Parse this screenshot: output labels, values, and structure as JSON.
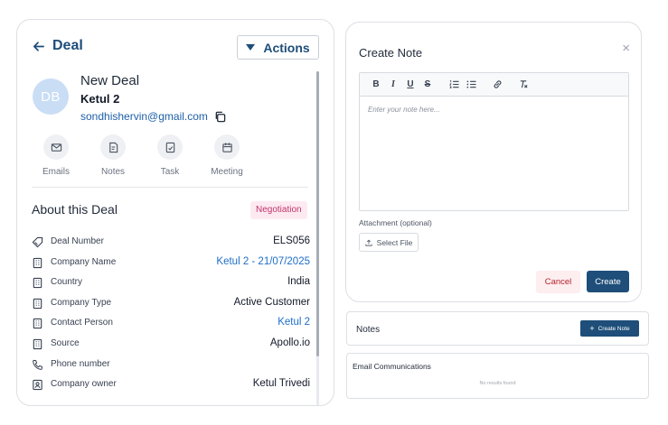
{
  "deal": {
    "back_label": "Deal",
    "actions_label": "Actions",
    "avatar_initials": "DB",
    "deal_name": "New Deal",
    "contact_name": "Ketul 2",
    "contact_email": "sondhishervin@gmail.com",
    "quick_actions": [
      {
        "label": "Emails",
        "icon": "mail-icon"
      },
      {
        "label": "Notes",
        "icon": "notes-icon"
      },
      {
        "label": "Task",
        "icon": "task-icon"
      },
      {
        "label": "Meeting",
        "icon": "calendar-icon"
      }
    ],
    "about_title": "About this Deal",
    "stage_badge": "Negotiation",
    "stage_badge_color": "#c2346b",
    "details": [
      {
        "label": "Deal Number",
        "value": "ELS056",
        "icon": "tag-icon",
        "link": false
      },
      {
        "label": "Company Name",
        "value": "Ketul 2 - 21/07/2025",
        "icon": "building-icon",
        "link": true
      },
      {
        "label": "Country",
        "value": "India",
        "icon": "building-icon",
        "link": false
      },
      {
        "label": "Company Type",
        "value": "Active Customer",
        "icon": "building-icon",
        "link": false
      },
      {
        "label": "Contact Person",
        "value": "Ketul 2",
        "icon": "building-icon",
        "link": true
      },
      {
        "label": "Source",
        "value": "Apollo.io",
        "icon": "building-icon",
        "link": false
      },
      {
        "label": "Phone number",
        "value": "",
        "icon": "phone-icon",
        "link": false
      },
      {
        "label": "Company owner",
        "value": "Ketul Trivedi",
        "icon": "user-badge-icon",
        "link": false
      }
    ]
  },
  "create_note": {
    "title": "Create Note",
    "close_label": "×",
    "toolbar": {
      "bold": "B",
      "italic": "I",
      "underline": "U",
      "strike": "S"
    },
    "editor_placeholder": "Enter your note here...",
    "attachment_label": "Attachment (optional)",
    "select_file_label": "Select File",
    "cancel_label": "Cancel",
    "create_label": "Create"
  },
  "notes_panel": {
    "title": "Notes",
    "create_note_label": "Create Note"
  },
  "email_panel": {
    "title": "Email Communications",
    "empty_text": "No results found"
  },
  "colors": {
    "brand": "#1e4e79",
    "link": "#1e6ec8",
    "cancel_bg": "#fdeef0",
    "cancel_text": "#b4232c",
    "badge_bg": "#fdeaf1"
  }
}
